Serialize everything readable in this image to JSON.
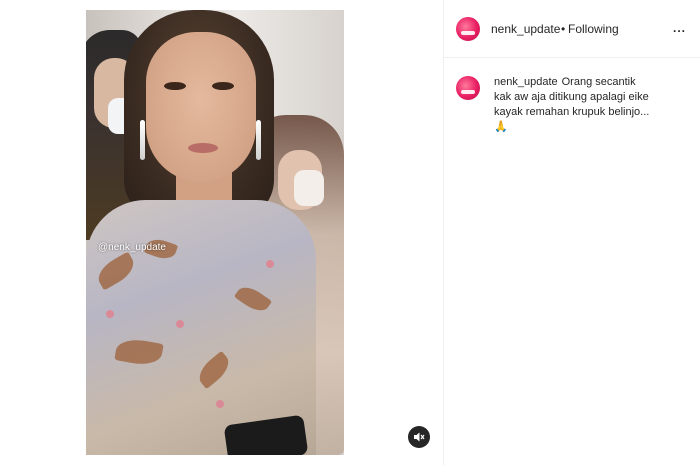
{
  "post": {
    "username": "nenk_update",
    "separator": "•",
    "follow_status": "Following",
    "more_label": "...",
    "video_watermark": "@nenk_update",
    "caption_username": "nenk_update",
    "caption_text": "Orang secantik kak aw aja ditikung apalagi eike kayak remahan krupuk belinjo... 🙏"
  },
  "icons": {
    "avatar": "avatar-icon",
    "mute": "speaker-mute-icon",
    "more": "more-options-icon"
  },
  "colors": {
    "avatar": "#e91e63",
    "text": "#262626",
    "divider": "#efefef"
  }
}
